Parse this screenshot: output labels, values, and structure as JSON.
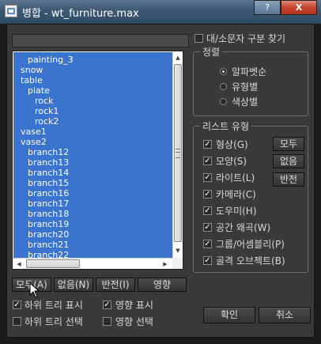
{
  "window": {
    "title": "병합 - wt_furniture.max",
    "help_label": "?",
    "close_label": "X"
  },
  "filter": {
    "case_sensitive_label": "대/소문자 구분 찾기",
    "case_sensitive_checked": false
  },
  "list": {
    "items": [
      {
        "text": "painting_3",
        "level": 1
      },
      {
        "text": "snow",
        "level": 0
      },
      {
        "text": "table",
        "level": 0
      },
      {
        "text": "plate",
        "level": 1
      },
      {
        "text": "rock",
        "level": 2
      },
      {
        "text": "rock1",
        "level": 2
      },
      {
        "text": "rock2",
        "level": 2
      },
      {
        "text": "vase1",
        "level": 0
      },
      {
        "text": "vase2",
        "level": 0
      },
      {
        "text": "branch12",
        "level": 1
      },
      {
        "text": "branch13",
        "level": 1
      },
      {
        "text": "branch14",
        "level": 1
      },
      {
        "text": "branch15",
        "level": 1
      },
      {
        "text": "branch16",
        "level": 1
      },
      {
        "text": "branch17",
        "level": 1
      },
      {
        "text": "branch18",
        "level": 1
      },
      {
        "text": "branch19",
        "level": 1
      },
      {
        "text": "branch20",
        "level": 1
      },
      {
        "text": "branch21",
        "level": 1
      },
      {
        "text": "branch22",
        "level": 1
      }
    ],
    "selection_color": "#3b74cf"
  },
  "list_buttons": {
    "all": "모두(A)",
    "none": "없음(N)",
    "invert": "반전(I)",
    "influence": "영향"
  },
  "options": {
    "show_subtree": {
      "label": "하위 트리 표시",
      "checked": true
    },
    "select_subtree": {
      "label": "하위 트리 선택",
      "checked": false
    },
    "show_influence": {
      "label": "영향 표시",
      "checked": true
    },
    "select_influence": {
      "label": "영향 선택",
      "checked": false
    }
  },
  "sort": {
    "title": "정렬",
    "options": [
      {
        "label": "알파벳순",
        "selected": true
      },
      {
        "label": "유형별",
        "selected": false
      },
      {
        "label": "색상별",
        "selected": false
      }
    ]
  },
  "list_types": {
    "title": "리스트 유형",
    "items": [
      {
        "label": "형상(G)",
        "checked": true
      },
      {
        "label": "모양(S)",
        "checked": true
      },
      {
        "label": "라이트(L)",
        "checked": true
      },
      {
        "label": "카메라(C)",
        "checked": true
      },
      {
        "label": "도우미(H)",
        "checked": true
      },
      {
        "label": "공간 왜곡(W)",
        "checked": true
      },
      {
        "label": "그룹/어셈블리(P)",
        "checked": true
      },
      {
        "label": "골격 오브젝트(B)",
        "checked": true
      }
    ],
    "all_label": "모두",
    "none_label": "없음",
    "invert_label": "반전"
  },
  "footer": {
    "ok_label": "확인",
    "cancel_label": "취소"
  }
}
